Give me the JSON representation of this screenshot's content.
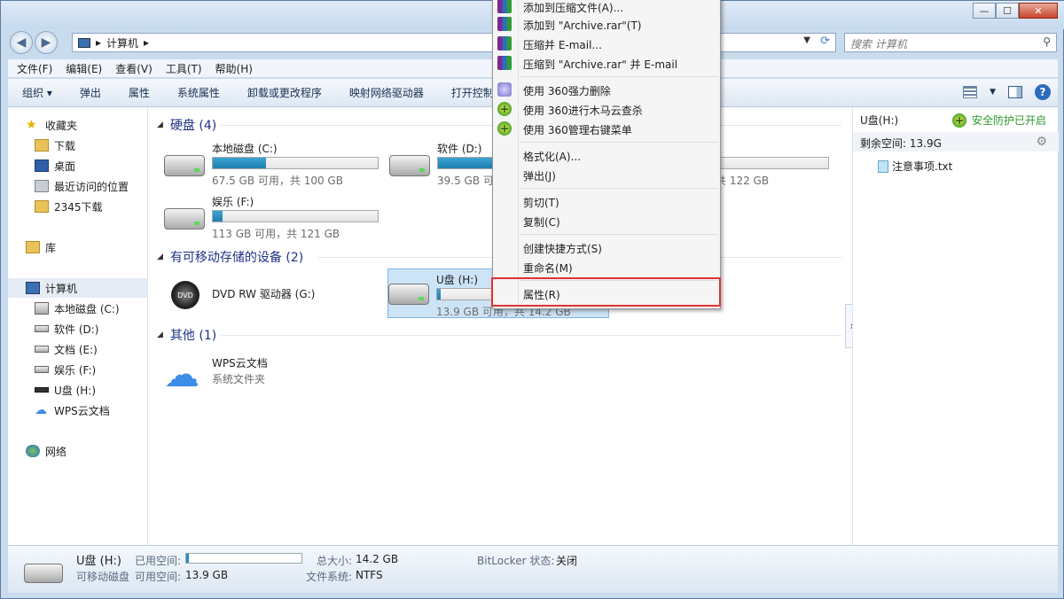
{
  "window": {
    "minimize": "—",
    "maximize": "☐",
    "close": "✕"
  },
  "address": {
    "computer": "计算机",
    "sep": "▸",
    "search_placeholder": "搜索 计算机"
  },
  "menubar": [
    "文件(F)",
    "编辑(E)",
    "查看(V)",
    "工具(T)",
    "帮助(H)"
  ],
  "cmdbar": [
    "组织 ▾",
    "弹出",
    "属性",
    "系统属性",
    "卸载或更改程序",
    "映射网络驱动器",
    "打开控制"
  ],
  "sidebar": {
    "favorites": "收藏夹",
    "downloads": "下载",
    "desktop": "桌面",
    "recent": "最近访问的位置",
    "dl2345": "2345下载",
    "library": "库",
    "computer": "计算机",
    "c": "本地磁盘 (C:)",
    "d": "软件 (D:)",
    "e": "文档 (E:)",
    "f": "娱乐 (F:)",
    "h": "U盘 (H:)",
    "wps": "WPS云文档",
    "network": "网络"
  },
  "groups": {
    "hdd": "硬盘 (4)",
    "removable": "有可移动存储的设备 (2)",
    "other": "其他 (1)"
  },
  "drives": {
    "c": {
      "name": "本地磁盘 (C:)",
      "sub": "67.5 GB 可用，共 100 GB",
      "used": 0.32
    },
    "d": {
      "name": "软件 (D:)",
      "sub": "39.5 GB 可",
      "used": 0.5
    },
    "e": {
      "sub": "，共 122 GB"
    },
    "f": {
      "name": "娱乐 (F:)",
      "sub": "113 GB 可用，共 121 GB",
      "used": 0.06
    },
    "g": {
      "name": "DVD RW 驱动器 (G:)"
    },
    "h": {
      "name": "U盘 (H:)",
      "sub": "13.9 GB 可用，共 14.2 GB",
      "used": 0.02
    },
    "wps": {
      "name": "WPS云文档",
      "sub": "系统文件夹"
    }
  },
  "preview": {
    "title": "U盘(H:)",
    "guard": "安全防护已开启",
    "space": "剩余空间: 13.9G",
    "file": "注意事项.txt"
  },
  "details": {
    "name": "U盘 (H:)",
    "type": "可移动磁盘",
    "used_label": "已用空间:",
    "free_label": "可用空间:",
    "free_value": "13.9 GB",
    "total_label": "总大小:",
    "total_value": "14.2 GB",
    "fs_label": "文件系统:",
    "fs_value": "NTFS",
    "bitlocker_label": "BitLocker 状态:",
    "bitlocker_value": "关闭"
  },
  "context_menu": {
    "add_archive": "添加到压缩文件(A)...",
    "add_rar": "添加到 \"Archive.rar\"(T)",
    "zip_email": "压缩并 E-mail...",
    "zip_rar_email": "压缩到 \"Archive.rar\" 并 E-mail",
    "del360": "使用 360强力删除",
    "scan360": "使用 360进行木马云查杀",
    "manage360": "使用 360管理右键菜单",
    "format": "格式化(A)...",
    "eject": "弹出(J)",
    "cut": "剪切(T)",
    "copy": "复制(C)",
    "shortcut": "创建快捷方式(S)",
    "rename": "重命名(M)",
    "properties": "属性(R)"
  },
  "colors": {
    "accent": "#1e3287",
    "highlight": "#e03131",
    "guard_green": "#2f9a2f"
  }
}
